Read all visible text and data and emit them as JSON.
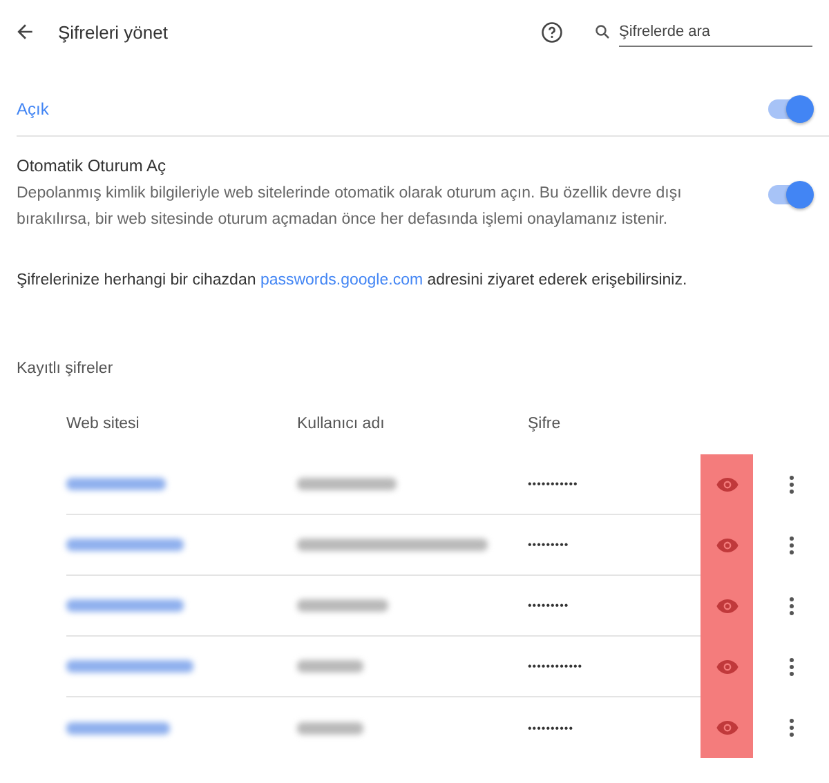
{
  "header": {
    "title": "Şifreleri yönet",
    "search": {
      "placeholder": "Şifrelerde ara"
    }
  },
  "save_passwords": {
    "label": "Açık",
    "on": true
  },
  "auto_signin": {
    "title": "Otomatik Oturum Aç",
    "description": "Depolanmış kimlik bilgileriyle web sitelerinde otomatik olarak oturum açın. Bu özellik devre dışı bırakılırsa, bir web sitesinde oturum açmadan önce her defasında işlemi onaylamanız istenir.",
    "on": true
  },
  "info": {
    "before": "Şifrelerinize herhangi bir cihazdan ",
    "link": "passwords.google.com",
    "after": " adresini ziyaret ederek erişebilirsiniz."
  },
  "saved": {
    "title": "Kayıtlı şifreler",
    "columns": [
      "Web sitesi",
      "Kullanıcı adı",
      "Şifre"
    ],
    "rows": [
      {
        "password": "•••••••••••",
        "highlighted": true
      },
      {
        "password": "•••••••••",
        "highlighted": true
      },
      {
        "password": "•••••••••",
        "highlighted": true
      },
      {
        "password": "••••••••••••",
        "highlighted": true
      },
      {
        "password": "••••••••••",
        "highlighted": true
      }
    ]
  }
}
